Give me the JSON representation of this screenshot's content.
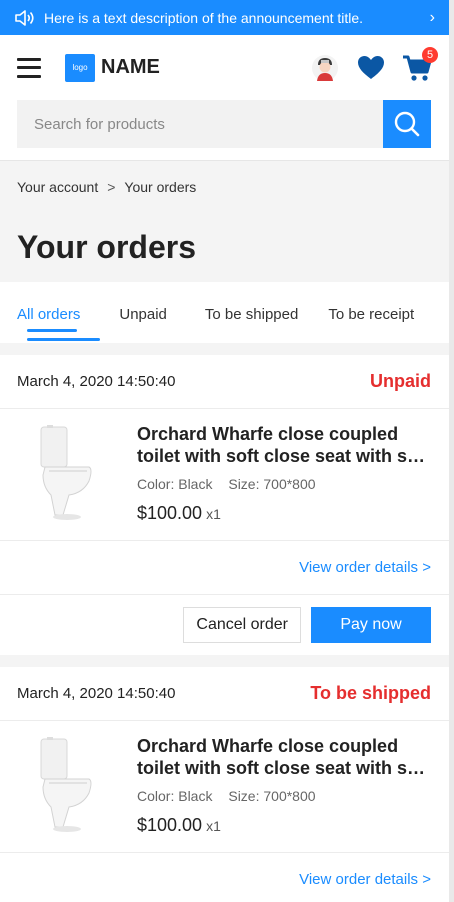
{
  "announcement": {
    "text": "Here is a text description of the announcement title.",
    "arrow": "›"
  },
  "header": {
    "logo_text": "logo",
    "brand": "NAME",
    "cart_count": "5"
  },
  "search": {
    "placeholder": "Search for products"
  },
  "breadcrumb": {
    "items": [
      "Your account",
      "Your orders"
    ],
    "separator": ">"
  },
  "page_title": "Your orders",
  "tabs": [
    {
      "label": "All orders",
      "active": true
    },
    {
      "label": "Unpaid"
    },
    {
      "label": "To be shipped"
    },
    {
      "label": "To be receipt"
    }
  ],
  "orders": [
    {
      "date": "March 4, 2020 14:50:40",
      "status": "Unpaid",
      "product_name": "Orchard Wharfe close coupled toilet with soft close seat with soft close seat",
      "color": "Color: Black",
      "size": "Size: 700*800",
      "price": "$100.00",
      "qty": "x1",
      "details_link": "View order details >",
      "cancel_label": "Cancel order",
      "pay_label": "Pay now"
    },
    {
      "date": "March 4, 2020 14:50:40",
      "status": "To be shipped",
      "product_name": "Orchard Wharfe close coupled toilet with soft close seat with soft close seat",
      "color": "Color: Black",
      "size": "Size: 700*800",
      "price": "$100.00",
      "qty": "x1",
      "details_link": "View order details >"
    }
  ],
  "colors": {
    "accent": "#1a8cff",
    "status_red": "#e52e2e",
    "heart": "#0b57a4"
  },
  "icons": [
    "speaker-icon",
    "chevron-right-icon",
    "menu-icon",
    "avatar-icon",
    "heart-icon",
    "cart-icon",
    "search-icon"
  ]
}
